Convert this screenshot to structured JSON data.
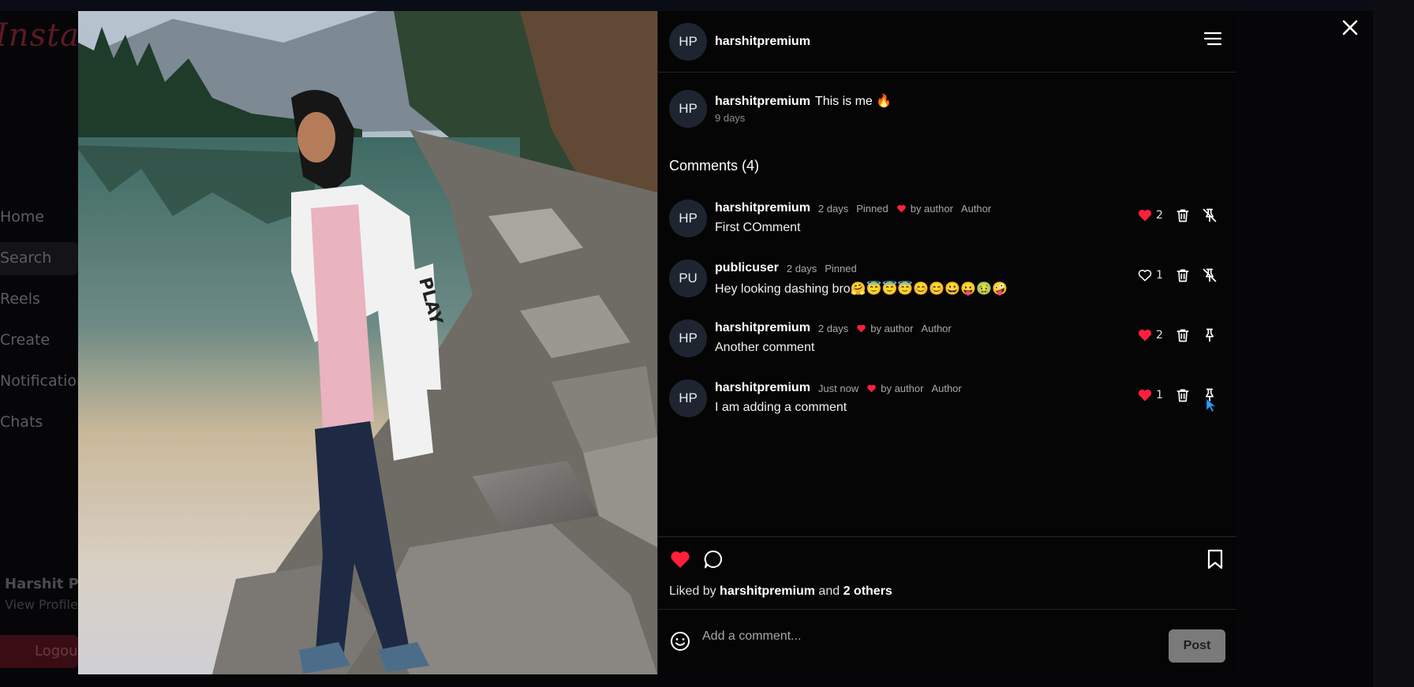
{
  "background_app": {
    "logo": "Instagram",
    "nav_items": [
      "Home",
      "Search",
      "Reels",
      "Create",
      "Notifications",
      "Chats"
    ],
    "profile_name": "Harshit Premium",
    "profile_link": "View Profile",
    "logout_label": "Logout"
  },
  "post": {
    "author_initials": "HP",
    "author": "harshitpremium",
    "caption": "This is me 🔥",
    "caption_time": "9 days",
    "comments_title": "Comments (4)",
    "comments": [
      {
        "initials": "HP",
        "user": "harshitpremium",
        "time": "2 days",
        "pinned_label": "Pinned",
        "liked_by_author": "by author",
        "author_badge": "Author",
        "text": "First COmment",
        "likes": "2",
        "liked": true,
        "pinned": true
      },
      {
        "initials": "PU",
        "user": "publicuser",
        "time": "2 days",
        "pinned_label": "Pinned",
        "liked_by_author": "",
        "author_badge": "",
        "text": "Hey looking dashing bro🤗😇😇😇😊😊😀😛🤢🤪",
        "likes": "1",
        "liked": false,
        "pinned": true
      },
      {
        "initials": "HP",
        "user": "harshitpremium",
        "time": "2 days",
        "pinned_label": "",
        "liked_by_author": "by author",
        "author_badge": "Author",
        "text": "Another comment",
        "likes": "2",
        "liked": true,
        "pinned": false
      },
      {
        "initials": "HP",
        "user": "harshitpremium",
        "time": "Just now",
        "pinned_label": "",
        "liked_by_author": "by author",
        "author_badge": "Author",
        "text": "I am adding a comment",
        "likes": "1",
        "liked": true,
        "pinned": false
      }
    ],
    "liked_by_prefix": "Liked by",
    "liked_by_user": "harshitpremium",
    "liked_by_and": "and",
    "liked_by_others": "2 others",
    "comment_placeholder": "Add a comment...",
    "post_button": "Post"
  },
  "colors": {
    "like_red": "#ff1f3d",
    "panel_bg": "#050505",
    "avatar_bg": "#1e2530",
    "cursor": "#29a3ff"
  }
}
